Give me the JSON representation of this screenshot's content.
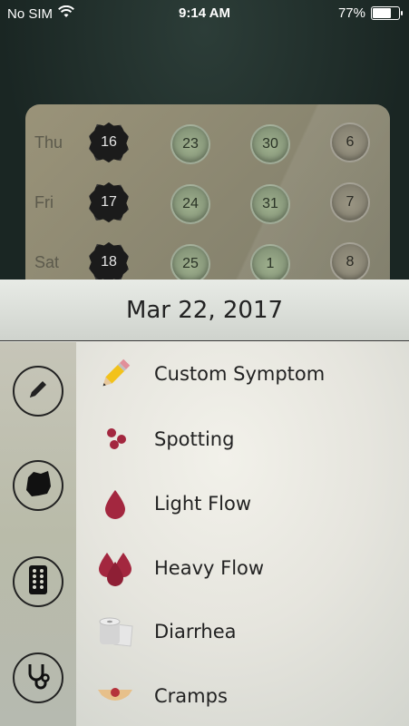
{
  "status_bar": {
    "carrier": "No SIM",
    "time": "9:14 AM",
    "battery_percent": "77%",
    "battery_level": 0.77
  },
  "pill_pack": {
    "rows": [
      {
        "day": "Thu",
        "pills": [
          "16",
          "23",
          "30",
          "6"
        ],
        "states": [
          "taken",
          "active",
          "active",
          "inactive"
        ]
      },
      {
        "day": "Fri",
        "pills": [
          "17",
          "24",
          "31",
          "7"
        ],
        "states": [
          "taken",
          "active",
          "active",
          "inactive"
        ]
      },
      {
        "day": "Sat",
        "pills": [
          "18",
          "25",
          "1",
          "8"
        ],
        "states": [
          "taken",
          "active",
          "active",
          "inactive"
        ]
      }
    ]
  },
  "sheet": {
    "date": "Mar 22, 2017",
    "rail_icons": [
      "pencil-icon",
      "torn-patch-icon",
      "pill-pack-icon",
      "stethoscope-icon"
    ],
    "items": [
      {
        "label": "Custom Symptom",
        "icon": "pencil-icon"
      },
      {
        "label": "Spotting",
        "icon": "dots-icon"
      },
      {
        "label": "Light Flow",
        "icon": "drop-icon"
      },
      {
        "label": "Heavy Flow",
        "icon": "drops-icon"
      },
      {
        "label": "Diarrhea",
        "icon": "toilet-paper-icon"
      },
      {
        "label": "Cramps",
        "icon": "cramps-icon"
      }
    ]
  },
  "colors": {
    "accent_red": "#a3273f",
    "background": "#1f2d2a",
    "sheet": "#ecebe4"
  }
}
